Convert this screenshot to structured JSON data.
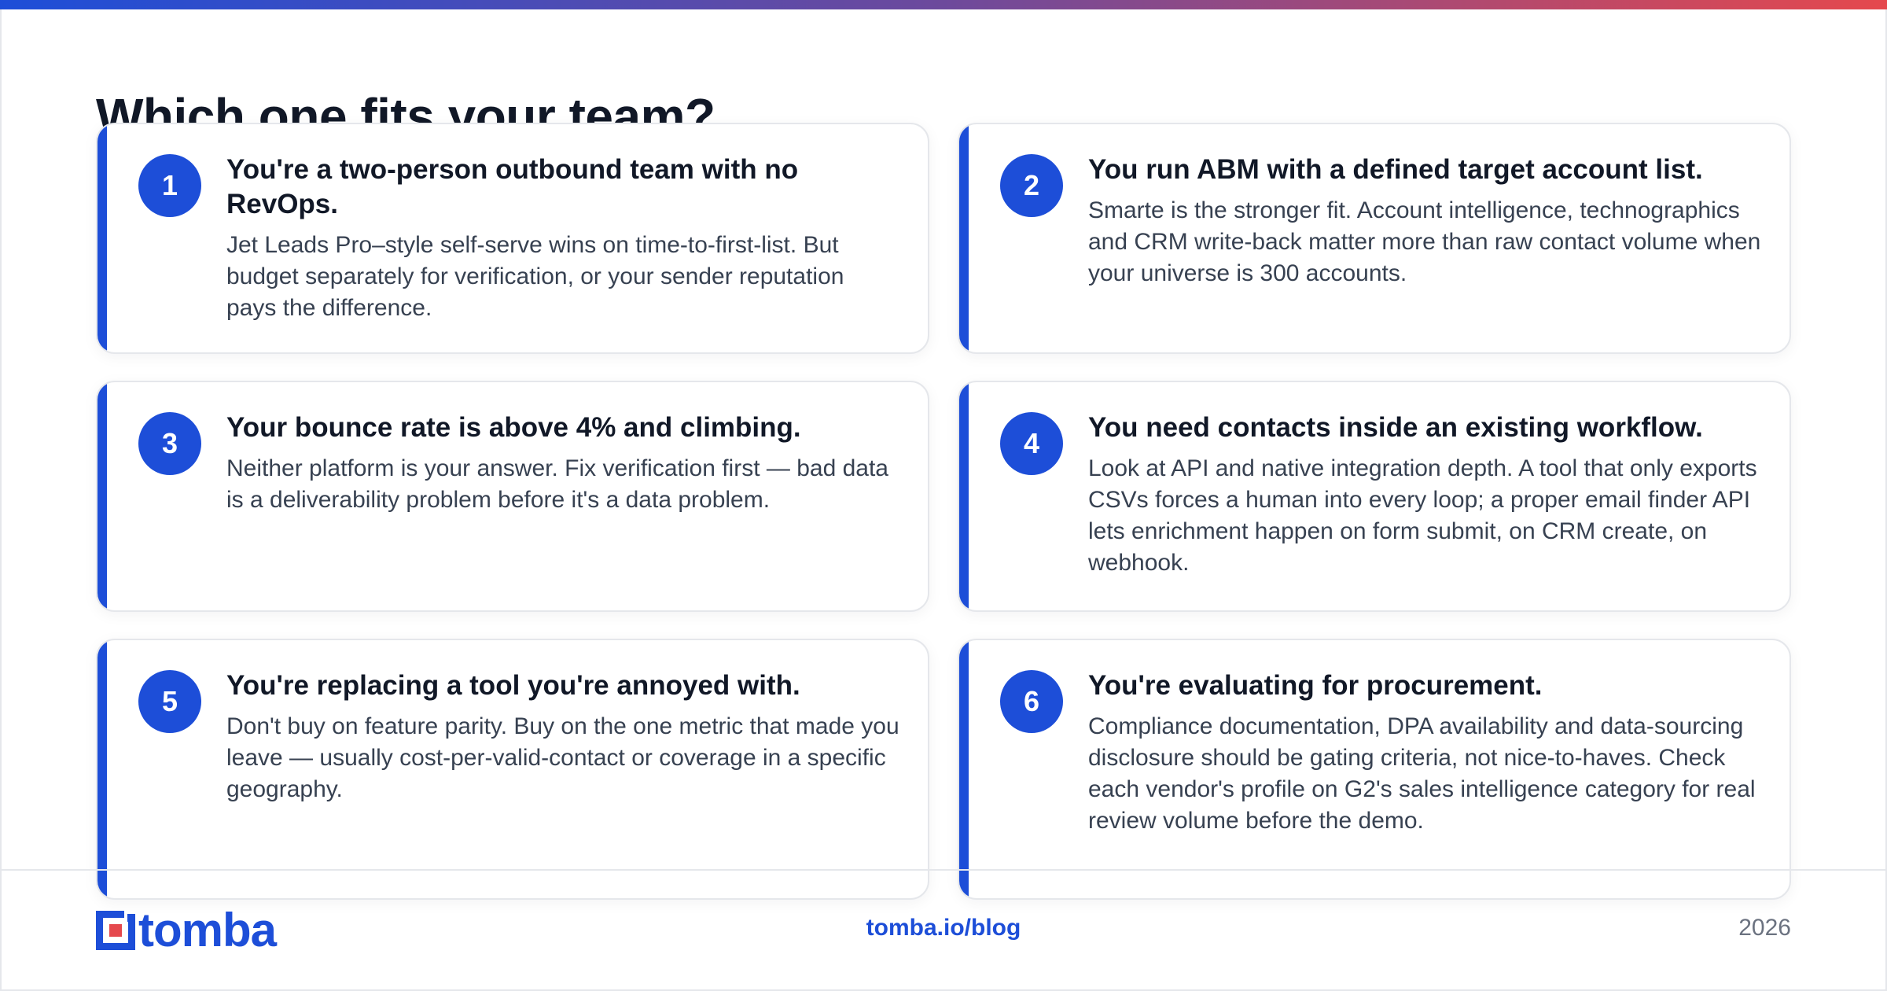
{
  "page": {
    "title": "Which one fits your team?",
    "accent_color": "#1d4ed8",
    "gradient_colors": [
      "#1d4ed8",
      "#e5484d"
    ]
  },
  "cards": [
    {
      "number": "1",
      "title": "You're a two-person outbound team with no RevOps.",
      "body": "Jet Leads Pro–style self-serve wins on time-to-first-list. But budget separately for verification, or your sender reputation pays the difference."
    },
    {
      "number": "2",
      "title": "You run ABM with a defined target account list.",
      "body": "Smarte is the stronger fit. Account intelligence, technographics and CRM write-back matter more than raw contact volume when your universe is 300 accounts."
    },
    {
      "number": "3",
      "title": "Your bounce rate is above 4% and climbing.",
      "body": "Neither platform is your answer. Fix verification first — bad data is a deliverability problem before it's a data problem."
    },
    {
      "number": "4",
      "title": "You need contacts inside an existing workflow.",
      "body": "Look at API and native integration depth. A tool that only exports CSVs forces a human into every loop; a proper email finder API lets enrichment happen on form submit, on CRM create, on webhook."
    },
    {
      "number": "5",
      "title": "You're replacing a tool you're annoyed with.",
      "body": "Don't buy on feature parity. Buy on the one metric that made you leave — usually cost-per-valid-contact or coverage in a specific geography."
    },
    {
      "number": "6",
      "title": "You're evaluating for procurement.",
      "body": "Compliance documentation, DPA availability and data-sourcing disclosure should be gating criteria, not nice-to-haves. Check each vendor's profile on G2's sales intelligence category for real review volume before the demo."
    }
  ],
  "footer": {
    "logo_text": "tomba",
    "logo_icon": "tomba-logo-icon",
    "link": "tomba.io/blog",
    "year": "2026"
  }
}
